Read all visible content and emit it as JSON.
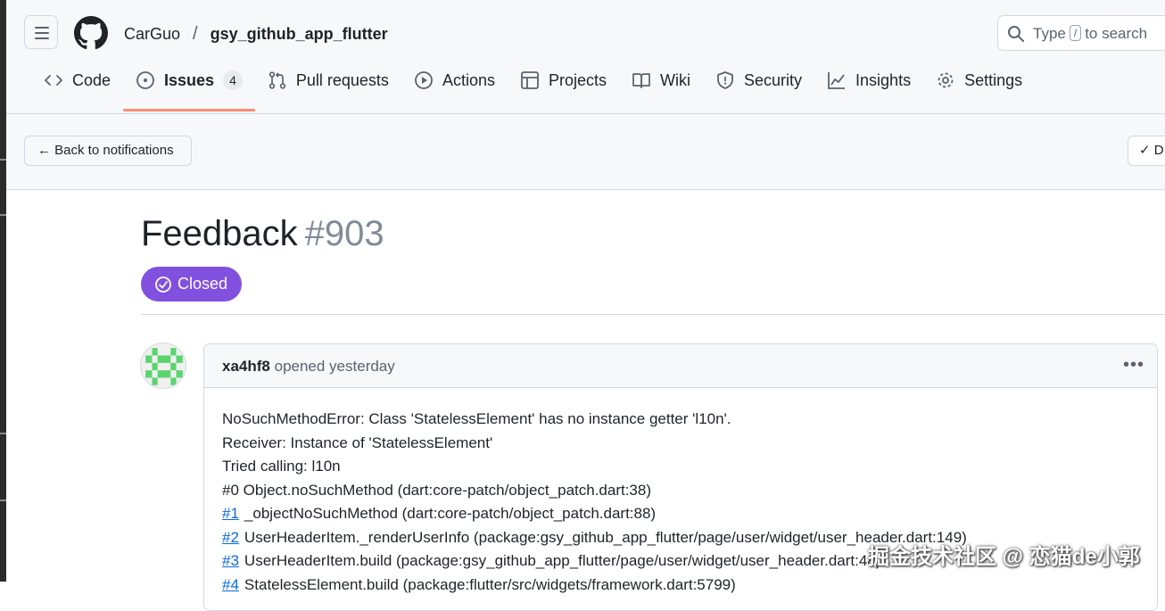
{
  "header": {
    "owner": "CarGuo",
    "separator": "/",
    "repo": "gsy_github_app_flutter",
    "search_prefix": "Type",
    "search_key": "/",
    "search_suffix": "to search"
  },
  "tabs": [
    {
      "label": "Code",
      "icon": "code-icon"
    },
    {
      "label": "Issues",
      "icon": "issue-opened-icon",
      "count": "4",
      "selected": true
    },
    {
      "label": "Pull requests",
      "icon": "git-pull-request-icon"
    },
    {
      "label": "Actions",
      "icon": "play-icon"
    },
    {
      "label": "Projects",
      "icon": "table-icon"
    },
    {
      "label": "Wiki",
      "icon": "book-icon"
    },
    {
      "label": "Security",
      "icon": "shield-icon"
    },
    {
      "label": "Insights",
      "icon": "graph-icon"
    },
    {
      "label": "Settings",
      "icon": "gear-icon"
    }
  ],
  "notification_bar": {
    "back_label": "← Back to notifications",
    "done_label": "✓ D"
  },
  "issue": {
    "title": "Feedback",
    "number": "#903",
    "state": "Closed",
    "state_color": "#8250df",
    "author": "xa4hf8",
    "action": "opened yesterday",
    "body_lines": [
      {
        "text": "NoSuchMethodError: Class 'StatelessElement' has no instance getter 'l10n'."
      },
      {
        "text": "Receiver: Instance of 'StatelessElement'"
      },
      {
        "text": "Tried calling: l10n"
      },
      {
        "text": "#0 Object.noSuchMethod (dart:core-patch/object_patch.dart:38)"
      },
      {
        "link": "#1",
        "text": "_objectNoSuchMethod (dart:core-patch/object_patch.dart:88)"
      },
      {
        "link": "#2",
        "text": "UserHeaderItem._renderUserInfo (package:gsy_github_app_flutter/page/user/widget/user_header.dart:149)"
      },
      {
        "link": "#3",
        "text": "UserHeaderItem.build (package:gsy_github_app_flutter/page/user/widget/user_header.dart:48)"
      },
      {
        "link": "#4",
        "text": "StatelessElement.build (package:flutter/src/widgets/framework.dart:5799)"
      }
    ]
  },
  "watermark": "掘金技术社区 @ 恋猫de小郭"
}
